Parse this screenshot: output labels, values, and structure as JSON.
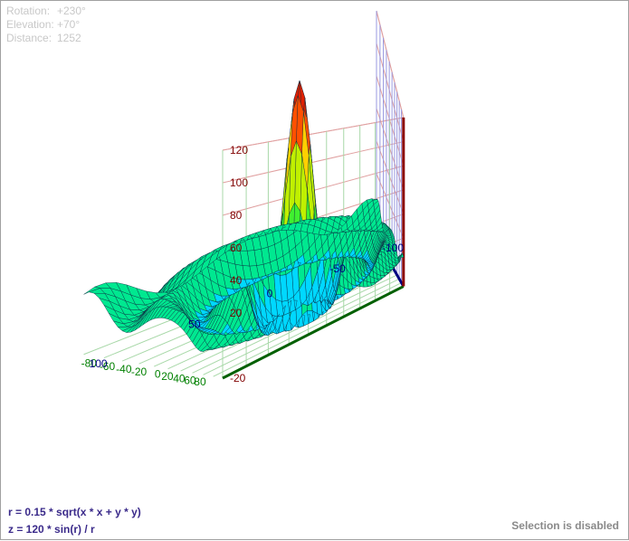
{
  "view": {
    "rotation_label": "Rotation:",
    "rotation_value": "+230°",
    "elevation_label": "Elevation:",
    "elevation_value": "+70°",
    "distance_label": "Distance:",
    "distance_value": "1252"
  },
  "formula": {
    "line1": "r = 0.15 * sqrt(x * x + y * y)",
    "line2": "z = 120  * sin(r) / r"
  },
  "status": "Selection is disabled",
  "colors": {
    "x_axis": "#000080",
    "y_axis": "#006000",
    "z_axis": "#8b0000",
    "x_grid": "#9a9ae0",
    "y_grid": "#a8d8a8",
    "z_grid": "#e0a0a0",
    "x_ticks": "#008000",
    "y_ticks": "#000080",
    "z_ticks": "#800000"
  },
  "chart_data": {
    "type": "surface",
    "function": "z = 120 * sin(r) / r, r = 0.15 * sqrt(x*x + y*y)",
    "x_range": [
      -100,
      100
    ],
    "y_range": [
      -100,
      100
    ],
    "z_range": [
      -20,
      120
    ],
    "mesh_samples": 41,
    "x_ticks": [
      -80,
      -60,
      -40,
      -20,
      0,
      20,
      40,
      60,
      80
    ],
    "y_ticks": [
      -100,
      -50,
      0,
      50,
      100
    ],
    "z_ticks": [
      -20,
      20,
      40,
      60,
      80,
      100,
      120
    ],
    "colormap": [
      "#00d8ff",
      "#00e890",
      "#40f030",
      "#c0f000",
      "#ffd000",
      "#ff5000",
      "#e02000"
    ]
  }
}
